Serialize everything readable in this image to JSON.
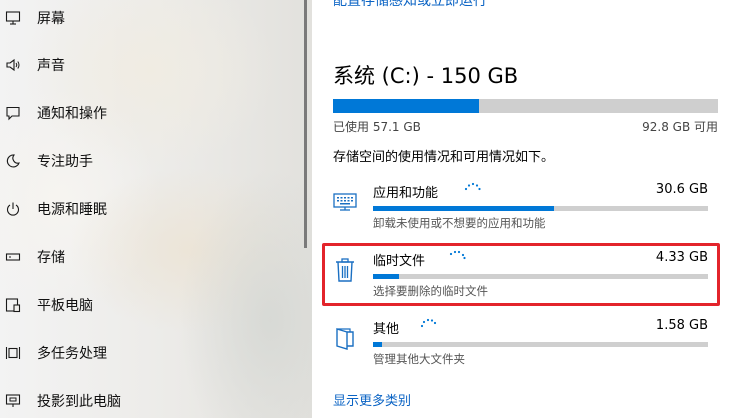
{
  "sidebar": {
    "items": [
      {
        "label": "屏幕",
        "icon": "monitor-icon"
      },
      {
        "label": "声音",
        "icon": "speaker-icon"
      },
      {
        "label": "通知和操作",
        "icon": "notification-icon"
      },
      {
        "label": "专注助手",
        "icon": "moon-icon"
      },
      {
        "label": "电源和睡眠",
        "icon": "power-icon"
      },
      {
        "label": "存储",
        "icon": "storage-drive-icon"
      },
      {
        "label": "平板电脑",
        "icon": "tablet-icon"
      },
      {
        "label": "多任务处理",
        "icon": "multitasking-icon"
      },
      {
        "label": "投影到此电脑",
        "icon": "project-icon"
      }
    ]
  },
  "main": {
    "top_link_cut": "配置存储感知或立即运行",
    "drive": {
      "title": "系统 (C:) - 150 GB",
      "used_label": "已使用 57.1 GB",
      "free_label": "92.8 GB 可用",
      "used_fraction": 0.38
    },
    "description": "存储空间的使用情况和可用情况如下。",
    "categories": [
      {
        "name": "应用和功能",
        "size": "30.6 GB",
        "subtitle": "卸载未使用或不想要的应用和功能",
        "fill_fraction": 0.54,
        "icon": "apps-keyboard-icon"
      },
      {
        "name": "临时文件",
        "size": "4.33 GB",
        "subtitle": "选择要删除的临时文件",
        "fill_fraction": 0.077,
        "icon": "trash-icon"
      },
      {
        "name": "其他",
        "size": "1.58 GB",
        "subtitle": "管理其他大文件夹",
        "fill_fraction": 0.028,
        "icon": "folder-icon"
      }
    ],
    "more_link": "显示更多类别"
  },
  "colors": {
    "accent": "#0078d7",
    "highlight": "#e3242b",
    "link": "#0a63c4"
  }
}
